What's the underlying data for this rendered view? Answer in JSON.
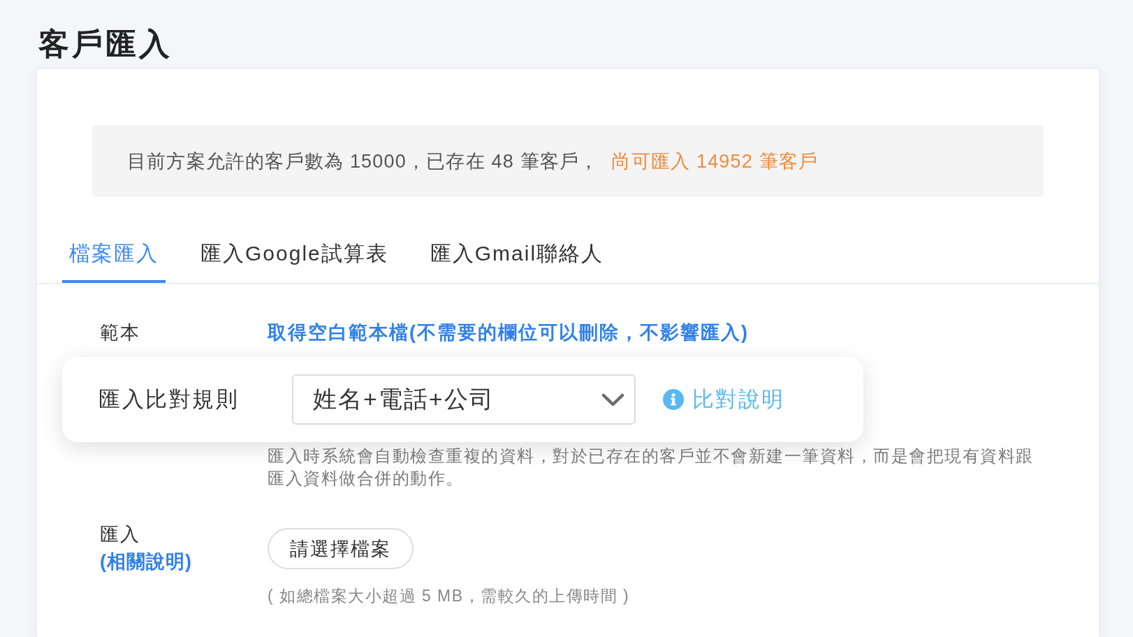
{
  "page_title": "客戶匯入",
  "quota_notice": {
    "text": "目前方案允許的客戶數為 15000，已存在 48 筆客戶，",
    "remaining": "尚可匯入 14952 筆客戶"
  },
  "tabs": [
    {
      "label": "檔案匯入",
      "selected": true
    },
    {
      "label": "匯入Google試算表",
      "selected": false
    },
    {
      "label": "匯入Gmail聯絡人",
      "selected": false
    }
  ],
  "template": {
    "label": "範本",
    "link": "取得空白範本檔(不需要的欄位可以刪除，不影響匯入)"
  },
  "match_rule": {
    "label": "匯入比對規則",
    "value": "姓名+電話+公司",
    "help_link": "比對說明",
    "description": "匯入時系統會自動檢查重複的資料，對於已存在的客戶並不會新建一筆資料，而是會把現有資料跟匯入資料做合併的動作。"
  },
  "file_import": {
    "label": "匯入",
    "help_link": "(相關說明)",
    "button": "請選擇檔案",
    "note": "( 如總檔案大小超過 5 MB，需較久的上傳時間 )"
  }
}
